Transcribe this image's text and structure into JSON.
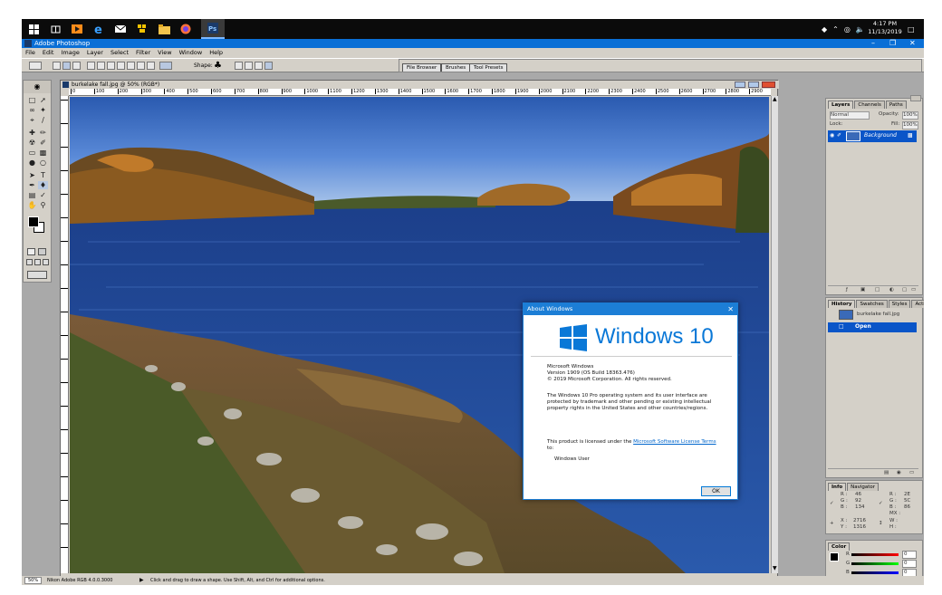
{
  "taskbar": {
    "icons": [
      "windows-start-icon",
      "task-view-icon",
      "media-icon",
      "edge-icon",
      "mail-icon",
      "game-icon",
      "folder-icon",
      "firefox-icon",
      "photoshop-icon"
    ],
    "clock_time": "4:17 PM",
    "clock_date": "11/13/2019"
  },
  "app": {
    "title": "Adobe Photoshop",
    "menu": [
      "File",
      "Edit",
      "Image",
      "Layer",
      "Select",
      "Filter",
      "View",
      "Window",
      "Help"
    ],
    "shape_label": "Shape:",
    "palette_tabs": [
      "File Browser",
      "Brushes",
      "Tool Presets"
    ]
  },
  "document": {
    "title": "burkelake fall.jpg @ 50% (RGB*)",
    "ruler_marks": [
      "0",
      "100",
      "200",
      "300",
      "400",
      "500",
      "600",
      "700",
      "800",
      "900",
      "1000",
      "1100",
      "1200",
      "1300",
      "1400",
      "1500",
      "1600",
      "1700",
      "1800",
      "1900",
      "2000",
      "2100",
      "2200",
      "2300",
      "2400",
      "2500",
      "2600",
      "2700",
      "2800",
      "2900"
    ]
  },
  "layers_panel": {
    "tabs": [
      "Layers",
      "Channels",
      "Paths"
    ],
    "blend_mode": "Normal",
    "opacity_label": "Opacity:",
    "opacity_value": "100%",
    "lock_label": "Lock:",
    "fill_label": "Fill:",
    "fill_value": "100%",
    "layer_name": "Background"
  },
  "history_panel": {
    "tabs": [
      "History",
      "Swatches",
      "Styles",
      "Actions"
    ],
    "snapshot": "burkelake fall.jpg",
    "step": "Open"
  },
  "info_panel": {
    "tabs": [
      "Info",
      "Navigator"
    ],
    "r1": "R :",
    "r1v": "46",
    "g1": "G :",
    "g1v": "92",
    "b1": "B :",
    "b1v": "134",
    "r2v": "2E",
    "g2v": "5C",
    "b2v": "86",
    "mx": "MX :",
    "x_label": "X :",
    "x_val": "2716",
    "y_label": "Y :",
    "y_val": "1316",
    "w_label": "W :",
    "h_label": "H :"
  },
  "color_panel": {
    "tab": "Color",
    "r": "R",
    "g": "G",
    "b": "B",
    "r_val": "0",
    "g_val": "0",
    "b_val": "0"
  },
  "about_dialog": {
    "title": "About Windows",
    "logo_text": "Windows 10",
    "line1": "Microsoft Windows",
    "line2": "Version 1909 (OS Build 18363.476)",
    "line3": "© 2019 Microsoft Corporation. All rights reserved.",
    "para": "The Windows 10 Pro operating system and its user interface are protected by trademark and other pending or existing intellectual property rights in the United States and other countries/regions.",
    "license_pre": "This product is licensed under the ",
    "license_link": "Microsoft Software License Terms",
    "license_post": " to:",
    "user": "Windows User",
    "ok": "OK"
  },
  "statusbar": {
    "zoom": "50%",
    "profile": "Nikon Adobe RGB 4.0.0.3000",
    "hint": "Click and drag to draw a shape. Use Shift, Alt, and Ctrl for additional options."
  },
  "colors": {
    "accent": "#1c7ed6",
    "titlebar": "#0a6fd6",
    "chrome": "#d4d0c8",
    "selection": "#0a55c8"
  }
}
